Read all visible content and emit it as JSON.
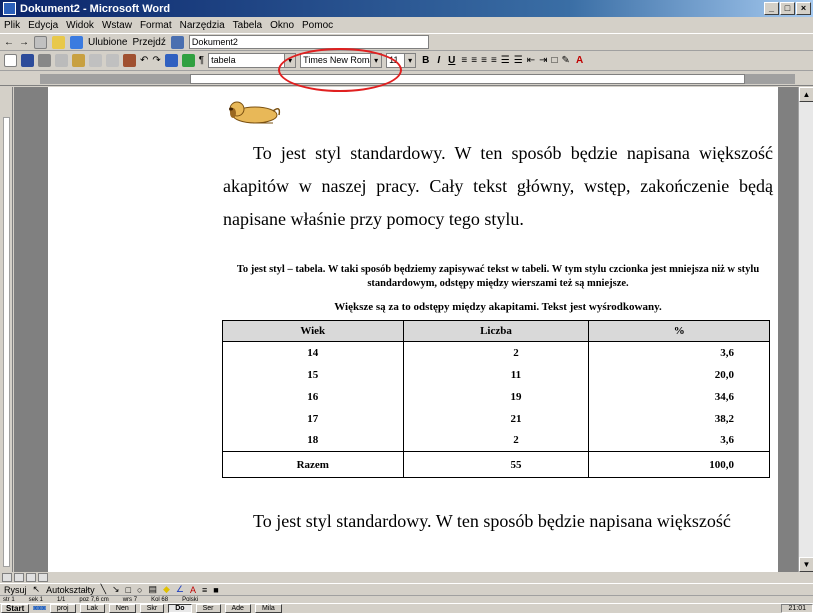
{
  "window": {
    "title": "Dokument2 - Microsoft Word"
  },
  "menu": [
    "Plik",
    "Edycja",
    "Widok",
    "Wstaw",
    "Format",
    "Narzędzia",
    "Tabela",
    "Okno",
    "Pomoc"
  ],
  "webbar": {
    "favorites": "Ulubione",
    "goto": "Przejdź",
    "address": "Dokument2"
  },
  "formatting": {
    "style": "tabela",
    "font": "Times New Roman",
    "size": "11"
  },
  "document": {
    "para1": "To jest styl standardowy. W ten sposób będzie napisana większość akapitów w naszej pracy. Cały tekst główny, wstęp, zakończenie będą napisane właśnie przy pomocy tego stylu.",
    "table_caption": "To jest styl – tabela. W taki sposób będziemy zapisywać tekst w tabeli. W tym stylu czcionka jest mniejsza niż w stylu standardowym, odstępy między wierszami też są mniejsze.",
    "table_caption2": "Większe są za to odstępy między akapitami. Tekst jest wyśrodkowany.",
    "table": {
      "headers": [
        "Wiek",
        "Liczba",
        "%"
      ],
      "rows": [
        [
          "14",
          "2",
          "3,6"
        ],
        [
          "15",
          "11",
          "20,0"
        ],
        [
          "16",
          "19",
          "34,6"
        ],
        [
          "17",
          "21",
          "38,2"
        ],
        [
          "18",
          "2",
          "3,6"
        ]
      ],
      "total": [
        "Razem",
        "55",
        "100,0"
      ]
    },
    "para2": "To jest styl standardowy. W ten sposób będzie napisana większość"
  },
  "drawbar": {
    "draw": "Rysuj",
    "autoshapes": "Autokształty"
  },
  "status": {
    "page": "str 1",
    "section": "sek 1",
    "pages": "1/1",
    "pos": "poz 7,6 cm",
    "line": "wrs 7",
    "col": "Kol 68",
    "lang": "Polski"
  },
  "taskbar": {
    "start": "Start",
    "tasks": [
      "proj",
      "Lak",
      "Nen",
      "Skr",
      "Do",
      "Ser",
      "Ade",
      "Mila"
    ],
    "active_task": "Do",
    "clock": "21:01"
  }
}
